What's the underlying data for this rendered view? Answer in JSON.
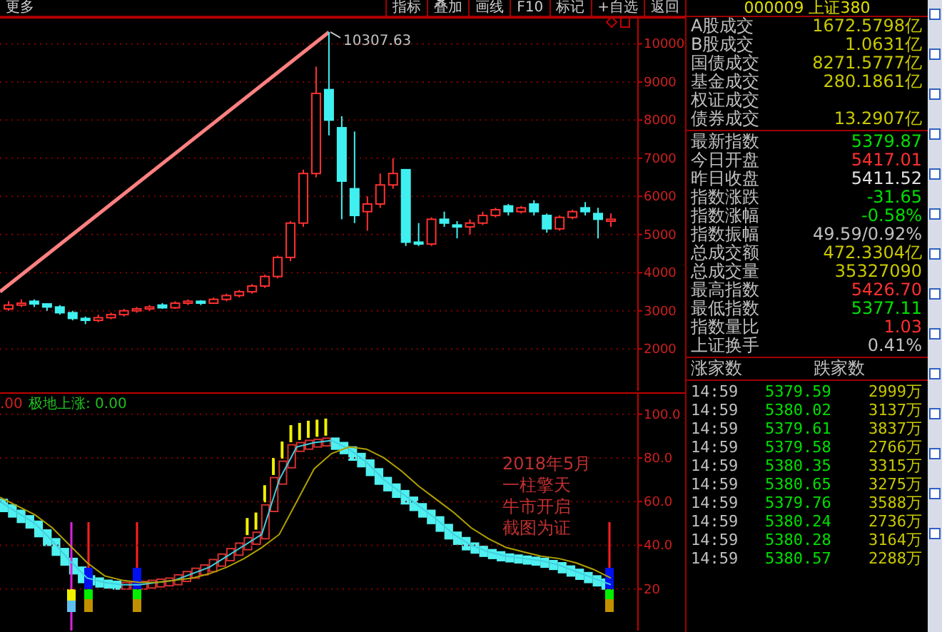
{
  "toolbar": {
    "left_label": "更多",
    "tabs": [
      "指标",
      "叠加",
      "画线",
      "F10",
      "标记",
      "+自选",
      "返回"
    ]
  },
  "price_chart": {
    "chart_data": {
      "type": "candlestick",
      "ylim": [
        900,
        10700
      ],
      "grid": true,
      "yticks": [
        {
          "value": 10000,
          "label": "10000"
        },
        {
          "value": 9000,
          "label": "9000"
        },
        {
          "value": 8000,
          "label": "8000"
        },
        {
          "value": 7000,
          "label": "7000"
        },
        {
          "value": 6000,
          "label": "6000"
        },
        {
          "value": 5000,
          "label": "5000"
        },
        {
          "value": 4000,
          "label": "4000"
        },
        {
          "value": 3000,
          "label": "3000"
        },
        {
          "value": 2000,
          "label": "2000"
        }
      ],
      "ohlc": [
        [
          3050,
          3250,
          3000,
          3150
        ],
        [
          3150,
          3300,
          3100,
          3200
        ],
        [
          3250,
          3300,
          3100,
          3180
        ],
        [
          3180,
          3200,
          3000,
          3100
        ],
        [
          3100,
          3150,
          2900,
          2950
        ],
        [
          2950,
          3000,
          2750,
          2800
        ],
        [
          2800,
          2850,
          2650,
          2750
        ],
        [
          2750,
          2900,
          2700,
          2820
        ],
        [
          2820,
          2950,
          2780,
          2900
        ],
        [
          2900,
          3050,
          2850,
          3000
        ],
        [
          3000,
          3100,
          2950,
          3050
        ],
        [
          3050,
          3150,
          3000,
          3100
        ],
        [
          3150,
          3200,
          3050,
          3080
        ],
        [
          3080,
          3250,
          3050,
          3200
        ],
        [
          3200,
          3300,
          3150,
          3250
        ],
        [
          3250,
          3280,
          3150,
          3200
        ],
        [
          3200,
          3350,
          3180,
          3300
        ],
        [
          3300,
          3450,
          3250,
          3400
        ],
        [
          3400,
          3550,
          3350,
          3500
        ],
        [
          3500,
          3700,
          3450,
          3650
        ],
        [
          3650,
          3950,
          3600,
          3900
        ],
        [
          3900,
          4450,
          3850,
          4400
        ],
        [
          4400,
          5350,
          4300,
          5300
        ],
        [
          5300,
          6700,
          5200,
          6600
        ],
        [
          6600,
          9400,
          6500,
          8700
        ],
        [
          8800,
          10307.63,
          7600,
          8000
        ],
        [
          7800,
          8100,
          5400,
          6400
        ],
        [
          6200,
          7700,
          5300,
          5500
        ],
        [
          5600,
          6000,
          5100,
          5800
        ],
        [
          5800,
          6600,
          5700,
          6300
        ],
        [
          6300,
          7000,
          6200,
          6600
        ],
        [
          6700,
          6700,
          4700,
          4800
        ],
        [
          4800,
          5300,
          4700,
          4750
        ],
        [
          4750,
          5450,
          4700,
          5400
        ],
        [
          5400,
          5600,
          5200,
          5300
        ],
        [
          5250,
          5350,
          4900,
          5200
        ],
        [
          5200,
          5400,
          5000,
          5300
        ],
        [
          5300,
          5600,
          5250,
          5500
        ],
        [
          5500,
          5700,
          5450,
          5650
        ],
        [
          5750,
          5800,
          5500,
          5600
        ],
        [
          5600,
          5750,
          5550,
          5700
        ],
        [
          5800,
          5900,
          5500,
          5600
        ],
        [
          5500,
          5550,
          5050,
          5150
        ],
        [
          5150,
          5500,
          5100,
          5450
        ],
        [
          5450,
          5650,
          5400,
          5600
        ],
        [
          5700,
          5850,
          5500,
          5600
        ],
        [
          5550,
          5700,
          4900,
          5400
        ],
        [
          5350,
          5550,
          5200,
          5400
        ]
      ],
      "annotations": [
        "10307.63"
      ]
    }
  },
  "indicator_chart": {
    "cut_value": ".00",
    "legend": "极地上涨: 0.00",
    "annotation": [
      "2018年5月",
      "一柱擎天",
      "牛市开启",
      "截图为证"
    ],
    "chart_data": {
      "type": "line",
      "ylim": [
        1,
        110
      ],
      "grid": true,
      "yticks": [
        {
          "value": 100,
          "label": "100.0"
        },
        {
          "value": 80,
          "label": "80.0"
        },
        {
          "value": 60,
          "label": "60.0"
        },
        {
          "value": 40,
          "label": "40.0"
        },
        {
          "value": 20,
          "label": "20"
        }
      ],
      "series": [
        {
          "color": "#40d0e0",
          "values": [
            60,
            55,
            50,
            42,
            33,
            25,
            23,
            22,
            22,
            23,
            24,
            27,
            30,
            35,
            40,
            45,
            70,
            85,
            87,
            88,
            84,
            78,
            70,
            64,
            58,
            52,
            45,
            40,
            37,
            35,
            34,
            33,
            31,
            28,
            25,
            22
          ]
        },
        {
          "color": "#b0a000",
          "values": [
            62,
            58,
            54,
            48,
            40,
            32,
            26,
            24,
            23,
            23,
            24,
            25,
            27,
            30,
            34,
            39,
            45,
            60,
            75,
            82,
            85,
            84,
            80,
            74,
            67,
            61,
            55,
            48,
            43,
            39,
            37,
            35,
            34,
            32,
            29,
            25
          ]
        }
      ]
    }
  },
  "quote_panel": {
    "title": "000009 上证380",
    "volume_rows": [
      {
        "label": "A股成交",
        "value": "1672.5798亿",
        "color": "#c8c800"
      },
      {
        "label": "B股成交",
        "value": "1.0631亿",
        "color": "#c8c800"
      },
      {
        "label": "国债成交",
        "value": "8271.5777亿",
        "color": "#c8c800"
      },
      {
        "label": "基金成交",
        "value": "280.1861亿",
        "color": "#c8c800"
      },
      {
        "label": "权证成交"
      },
      {
        "label": "债券成交",
        "value": "13.2907亿",
        "color": "#c8c800"
      }
    ],
    "index_rows": [
      {
        "label": "最新指数",
        "value": "5379.87",
        "color": "#00e000"
      },
      {
        "label": "今日开盘",
        "value": "5417.01",
        "color": "#ff3030"
      },
      {
        "label": "昨日收盘",
        "value": "5411.52",
        "color": "#e0e0e0"
      },
      {
        "label": "指数涨跌",
        "value": "-31.65",
        "color": "#00e000"
      },
      {
        "label": "指数涨幅",
        "value": "-0.58%",
        "color": "#00e000"
      },
      {
        "label": "指数振幅",
        "value": "49.59/0.92%",
        "color": "#c0c0c0"
      },
      {
        "label": "总成交额",
        "value": "472.3304亿",
        "color": "#c8c800"
      },
      {
        "label": "总成交量",
        "value": "35327090",
        "color": "#c8c800"
      },
      {
        "label": "最高指数",
        "value": "5426.70",
        "color": "#ff3030"
      },
      {
        "label": "最低指数",
        "value": "5377.11",
        "color": "#00e000"
      },
      {
        "label": "指数量比",
        "value": "1.03",
        "color": "#ff3030"
      },
      {
        "label": "上证换手",
        "value": "0.41%",
        "color": "#c0c0c0"
      }
    ],
    "ticks_header": [
      "涨家数",
      "跌家数"
    ],
    "ticks": [
      {
        "time": "14:59",
        "price": "5379.59",
        "volume": "2999万"
      },
      {
        "time": "14:59",
        "price": "5380.02",
        "volume": "3137万"
      },
      {
        "time": "14:59",
        "price": "5379.61",
        "volume": "3837万"
      },
      {
        "time": "14:59",
        "price": "5379.58",
        "volume": "2766万"
      },
      {
        "time": "14:59",
        "price": "5380.35",
        "volume": "3315万"
      },
      {
        "time": "14:59",
        "price": "5380.65",
        "volume": "3275万"
      },
      {
        "time": "14:59",
        "price": "5379.76",
        "volume": "3588万"
      },
      {
        "time": "14:59",
        "price": "5380.24",
        "volume": "2736万"
      },
      {
        "time": "14:59",
        "price": "5380.28",
        "volume": "3164万"
      },
      {
        "time": "14:59",
        "price": "5380.57",
        "volume": "2288万"
      }
    ]
  }
}
